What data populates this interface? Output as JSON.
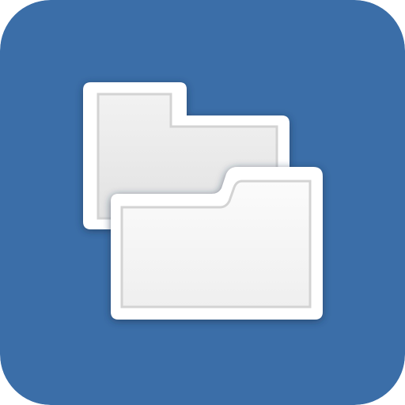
{
  "app_icon": {
    "name": "folders-icon",
    "description_icon": "two-folders-icon",
    "colors": {
      "tile_background": "#3B6EA8",
      "folder_fill_back": "#E9E9E9",
      "folder_fill_front": "#F6F6F6",
      "folder_border": "#FFFFFF",
      "folder_inner_stroke": "#D3D3D3",
      "shadow": "#1F3450"
    }
  }
}
